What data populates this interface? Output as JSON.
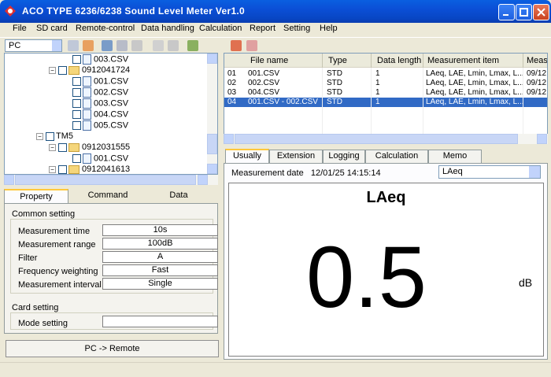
{
  "window": {
    "title": "ACO TYPE 6236/6238 Sound Level Meter Ver1.0"
  },
  "menu": [
    "File",
    "SD card",
    "Remote-control",
    "Data handling",
    "Calculation",
    "Report",
    "Setting",
    "Help"
  ],
  "toolbar": {
    "source_select": "PC"
  },
  "tree": [
    {
      "label": "003.CSV"
    },
    {
      "label": "0912041724"
    },
    {
      "label": "001.CSV"
    },
    {
      "label": "002.CSV"
    },
    {
      "label": "003.CSV"
    },
    {
      "label": "004.CSV"
    },
    {
      "label": "005.CSV"
    },
    {
      "label": "TM5"
    },
    {
      "label": "0912031555"
    },
    {
      "label": "001.CSV"
    },
    {
      "label": "0912041613"
    }
  ],
  "left_tabs": [
    "Property",
    "Command",
    "Data"
  ],
  "property": {
    "common_setting": "Common setting",
    "rows": [
      {
        "label": "Measurement time",
        "value": "10s"
      },
      {
        "label": "Measurement range",
        "value": "100dB"
      },
      {
        "label": "Filter",
        "value": "A"
      },
      {
        "label": "Frequency weighting",
        "value": "Fast"
      },
      {
        "label": "Measurement interval",
        "value": "Single"
      }
    ],
    "card_setting": "Card setting",
    "mode_setting": {
      "label": "Mode setting",
      "value": ""
    }
  },
  "remote_button": "PC -> Remote",
  "filelist": {
    "headers": [
      "File name",
      "Type",
      "Data length",
      "Measurement item",
      "Measu"
    ],
    "rows": [
      {
        "no": "01",
        "file": "001.CSV",
        "type": "STD",
        "length": "1",
        "item": "LAeq, LAE, Lmin, Lmax, L...",
        "date": "09/12"
      },
      {
        "no": "02",
        "file": "002.CSV",
        "type": "STD",
        "length": "1",
        "item": "LAeq, LAE, Lmin, Lmax, L...",
        "date": "09/12"
      },
      {
        "no": "03",
        "file": "004.CSV",
        "type": "STD",
        "length": "1",
        "item": "LAeq, LAE, Lmin, Lmax, L...",
        "date": "09/12"
      },
      {
        "no": "04",
        "file": "001.CSV - 002.CSV",
        "type": "STD",
        "length": "1",
        "item": "LAeq, LAE, Lmin, Lmax, L...",
        "date": ""
      }
    ]
  },
  "right_tabs": [
    "Usually",
    "Extension",
    "Logging",
    "Calculation",
    "Memo"
  ],
  "usually": {
    "date_label": "Measurement date",
    "date_value": "12/01/25 14:15:14",
    "selector": "LAeq",
    "display_label": "LAeq",
    "display_value": "0.5",
    "unit": "dB"
  },
  "colors": {
    "title_bar": "#0b4fd6",
    "selection": "#316ac5",
    "tab_highlight": "#ffc83c"
  }
}
